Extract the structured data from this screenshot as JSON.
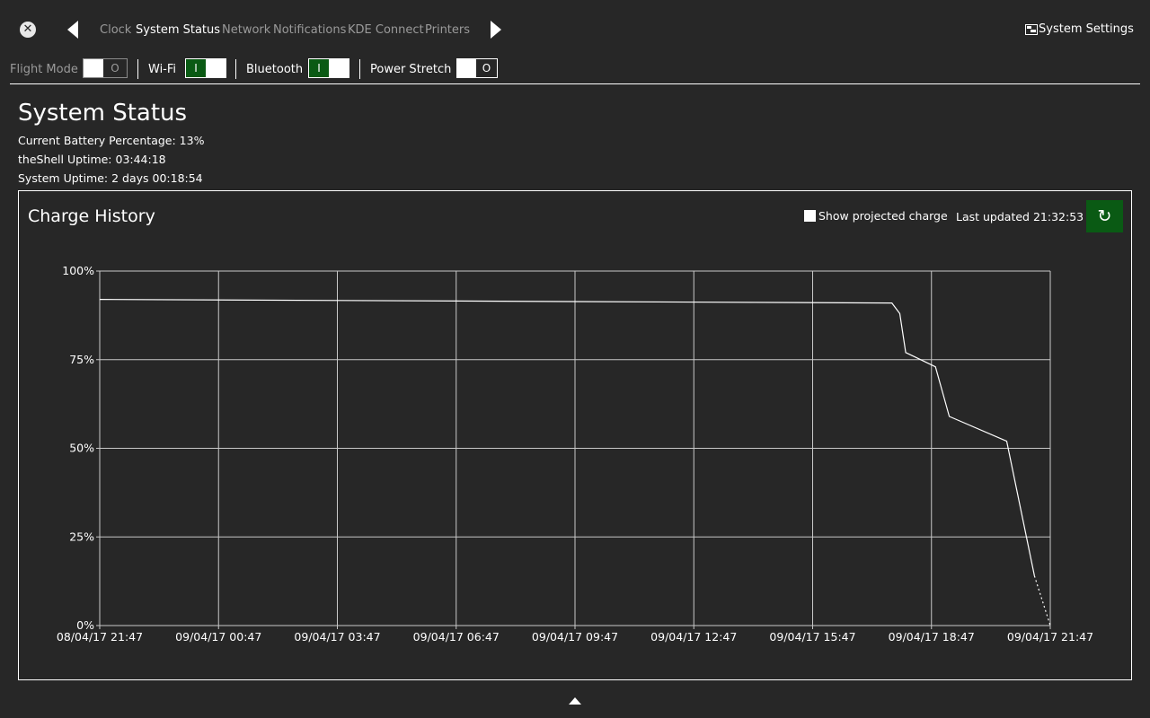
{
  "topbar": {
    "close_glyph": "✕",
    "tabs": [
      "Clock",
      "System Status",
      "Network",
      "Notifications",
      "KDE Connect",
      "Printers"
    ],
    "active_tab": "System Status",
    "settings_label": "System Settings"
  },
  "quick": {
    "flight_mode": {
      "label": "Flight Mode",
      "state": "off",
      "off_text": "O",
      "enabled": false
    },
    "wifi": {
      "label": "Wi-Fi",
      "state": "on",
      "on_text": "I"
    },
    "bluetooth": {
      "label": "Bluetooth",
      "state": "on",
      "on_text": "I"
    },
    "power_stretch": {
      "label": "Power Stretch",
      "state": "off",
      "off_text": "O"
    }
  },
  "status": {
    "title": "System Status",
    "battery": "Current Battery Percentage: 13%",
    "shell_uptime": "theShell Uptime: 03:44:18",
    "system_uptime": "System Uptime: 2 days 00:18:54"
  },
  "panel": {
    "title": "Charge History",
    "projected_label": "Show projected charge",
    "projected_checked": false,
    "last_updated": "Last updated 21:32:53",
    "refresh_glyph": "↻"
  },
  "colors": {
    "background": "#272727",
    "accent_green": "#0a5a14",
    "foreground": "#ffffff"
  },
  "chart_data": {
    "type": "line",
    "title": "Charge History",
    "y_ticks": [
      "100%",
      "75%",
      "50%",
      "25%",
      "0%"
    ],
    "ylim": [
      0,
      100
    ],
    "x_ticks": [
      "08/04/17 21:47",
      "09/04/17 00:47",
      "09/04/17 03:47",
      "09/04/17 06:47",
      "09/04/17 09:47",
      "09/04/17 12:47",
      "09/04/17 15:47",
      "09/04/17 18:47",
      "09/04/17 21:47"
    ],
    "x_unit": "hours",
    "xlim": [
      0,
      24
    ],
    "grid": true,
    "series": [
      {
        "style": "solid",
        "points": [
          [
            0,
            92
          ],
          [
            20.0,
            91
          ],
          [
            20.2,
            88
          ],
          [
            20.35,
            77
          ],
          [
            21.1,
            73
          ],
          [
            21.45,
            59
          ],
          [
            22.9,
            52
          ],
          [
            23.6,
            14
          ]
        ]
      },
      {
        "style": "dotted",
        "points": [
          [
            23.6,
            14
          ],
          [
            24,
            0
          ]
        ]
      }
    ]
  }
}
